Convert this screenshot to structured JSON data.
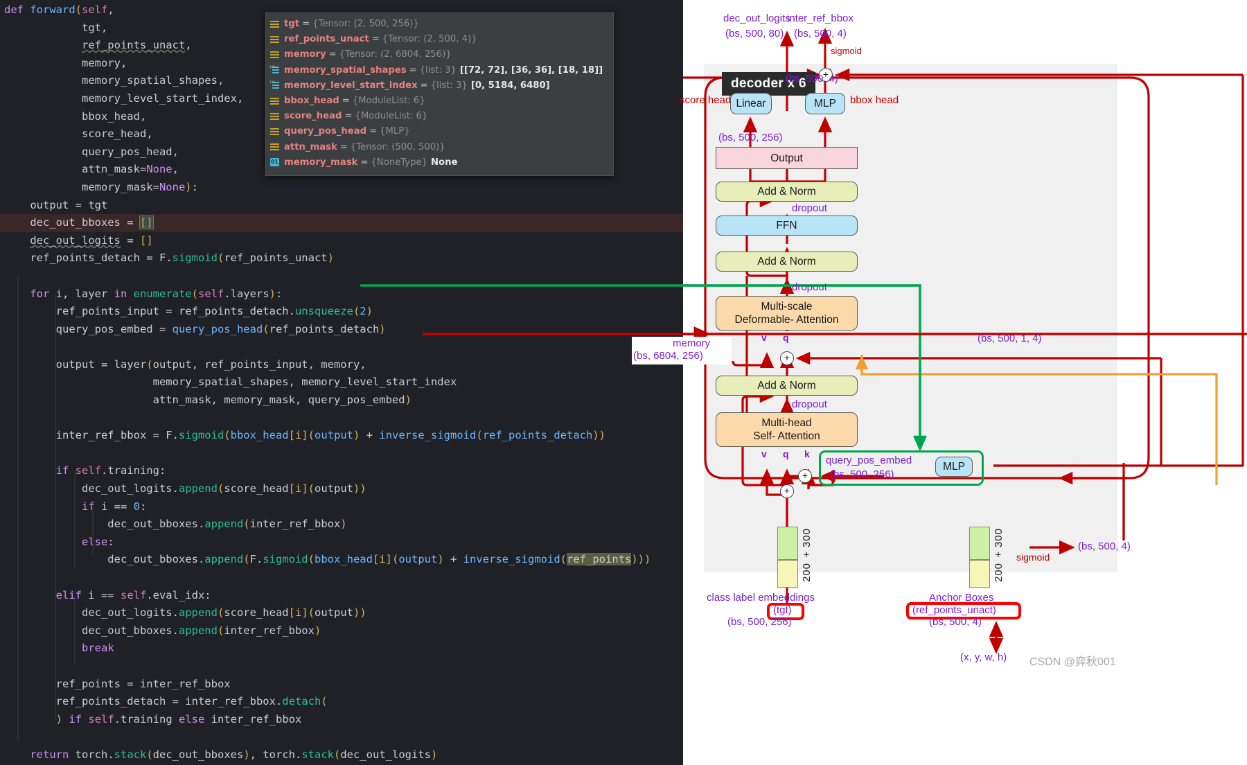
{
  "code_editor": {
    "language": "python",
    "lines": [
      "def forward(self,",
      "            tgt,",
      "            ref_points_unact,",
      "            memory,",
      "            memory_spatial_shapes,",
      "            memory_level_start_index,",
      "            bbox_head,",
      "            score_head,",
      "            query_pos_head,",
      "            attn_mask=None,",
      "            memory_mask=None):",
      "    output = tgt",
      "    dec_out_bboxes = []",
      "    dec_out_logits = []",
      "    ref_points_detach = F.sigmoid(ref_points_unact)",
      "",
      "    for i, layer in enumerate(self.layers):",
      "        ref_points_input = ref_points_detach.unsqueeze(2)",
      "        query_pos_embed = query_pos_head(ref_points_detach)",
      "",
      "        output = layer(output, ref_points_input, memory,",
      "                       memory_spatial_shapes, memory_level_start_index",
      "                       attn_mask, memory_mask, query_pos_embed)",
      "",
      "        inter_ref_bbox = F.sigmoid(bbox_head[i](output) + inverse_sigmoid(ref_points_detach))",
      "",
      "        if self.training:",
      "            dec_out_logits.append(score_head[i](output))",
      "            if i == 0:",
      "                dec_out_bboxes.append(inter_ref_bbox)",
      "            else:",
      "                dec_out_bboxes.append(F.sigmoid(bbox_head[i](output) + inverse_sigmoid(ref_points)))",
      "",
      "        elif i == self.eval_idx:",
      "            dec_out_logits.append(score_head[i](output))",
      "            dec_out_bboxes.append(inter_ref_bbox)",
      "            break",
      "",
      "        ref_points = inter_ref_bbox",
      "        ref_points_detach = inter_ref_bbox.detach(",
      "        ) if self.training else inter_ref_bbox",
      "",
      "    return torch.stack(dec_out_bboxes), torch.stack(dec_out_logits)"
    ],
    "highlighted_line": "dec_out_bboxes = []",
    "selected_token": "[]",
    "highlighted_token_2": "ref_points"
  },
  "debugger_tooltip": {
    "rows": [
      {
        "icon": "variable-icon",
        "name": "tgt",
        "type": "{Tensor: (2, 500, 256)}",
        "value": ""
      },
      {
        "icon": "variable-icon",
        "name": "ref_points_unact",
        "type": "{Tensor: (2, 500, 4)}",
        "value": ""
      },
      {
        "icon": "variable-icon",
        "name": "memory",
        "type": "{Tensor: (2, 6804, 256)}",
        "value": ""
      },
      {
        "icon": "list-icon",
        "name": "memory_spatial_shapes",
        "type": "{list: 3}",
        "value": "[[72, 72], [36, 36], [18, 18]]"
      },
      {
        "icon": "list-icon",
        "name": "memory_level_start_index",
        "type": "{list: 3}",
        "value": "[0, 5184, 6480]"
      },
      {
        "icon": "variable-icon",
        "name": "bbox_head",
        "type": "{ModuleList: 6}",
        "value": ""
      },
      {
        "icon": "variable-icon",
        "name": "score_head",
        "type": "{ModuleList: 6}",
        "value": ""
      },
      {
        "icon": "variable-icon",
        "name": "query_pos_head",
        "type": "{MLP}",
        "value": ""
      },
      {
        "icon": "variable-icon",
        "name": "attn_mask",
        "type": "{Tensor: (500, 500)}",
        "value": ""
      },
      {
        "icon": "bool-icon",
        "name": "memory_mask",
        "type": "{NoneType}",
        "value": "None"
      }
    ]
  },
  "diagram": {
    "title": "decoder x 6",
    "outputs": {
      "logits_name": "dec_out_logits",
      "logits_shape": "(bs, 500, 80)",
      "bbox_name": "inter_ref_bbox",
      "bbox_shape": "(bs, 500, 4)",
      "sigmoid_label": "sigmoid"
    },
    "heads": {
      "score_head_label": "score head",
      "score_head_box": "Linear",
      "bbox_head_label": "bbox head",
      "bbox_head_box": "MLP"
    },
    "blocks": {
      "output": "Output",
      "add_norm": "Add & Norm",
      "ffn": "FFN",
      "msda_line1": "Multi-scale",
      "msda_line2": "Deformable- Attention",
      "mhsa_line1": "Multi-head",
      "mhsa_line2": "Self- Attention",
      "dropout": "dropout"
    },
    "shapes": {
      "output_shape": "(bs, 500, 256)",
      "bbox_branch_shape": "(bs, 500, 4)",
      "memory_label": "memory",
      "memory_shape": "(bs, 6804, 256)",
      "ref_points_input_shape": "(bs, 500, 1, 4)",
      "query_pos_embed_label": "query_pos_embed",
      "query_pos_embed_shape": "(bs, 500,  256)",
      "query_pos_mlp": "MLP"
    },
    "qkv": {
      "v": "v",
      "q": "q",
      "k": "k"
    },
    "plus_symbol": "+",
    "embeddings": {
      "left": {
        "caption": "class label embeddings",
        "var": "(tgt)",
        "shape": "(bs, 500, 256)",
        "split_top": "300",
        "split_plus": "+",
        "split_bottom": "200"
      },
      "right": {
        "caption": "Anchor Boxes",
        "var": "(ref_points_unact)",
        "shape": "(bs, 500,  4)",
        "split_top": "300",
        "split_plus": "+",
        "split_bottom": "200",
        "sigmoid_label": "sigmoid",
        "sigmoid_out": "(bs, 500,  4)",
        "coords": "(x, y, w, h)"
      }
    },
    "watermark": "CSDN @弈秋001",
    "colors": {
      "accent_red": "#c00000",
      "accent_green": "#00a64f",
      "accent_orange": "#f0a030",
      "label_purple": "#7a1fd1",
      "box_blue": "#b9e4f7",
      "box_pink": "#fbd5dd",
      "box_olive": "#e8eeb9",
      "box_orange": "#fbd9ab",
      "box_green": "#ccf0a8",
      "box_yellow": "#f7f5b8"
    }
  }
}
